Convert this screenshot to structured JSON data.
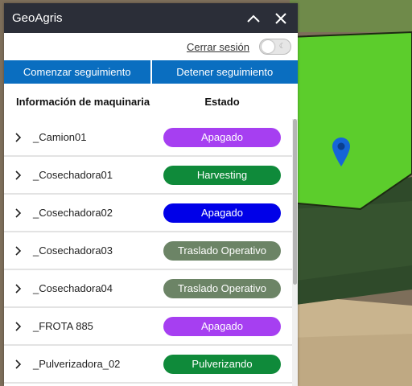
{
  "app": {
    "title": "GeoAgris"
  },
  "titlebar": {
    "collapse_icon": "chevron-up-icon",
    "close_icon": "close-icon"
  },
  "session": {
    "logout_label": "Cerrar sesión",
    "dark_mode_toggle": "off"
  },
  "actions": {
    "start_label": "Comenzar seguimiento",
    "stop_label": "Detener seguimiento",
    "color": "#0a6ec0"
  },
  "table": {
    "headers": {
      "info": "Información de maquinaria",
      "state": "Estado"
    },
    "rows": [
      {
        "name": "_Camion01",
        "status": "Apagado",
        "color": "#a63ff1"
      },
      {
        "name": "_Cosechadora01",
        "status": "Harvesting",
        "color": "#0f8a3a"
      },
      {
        "name": "_Cosechadora02",
        "status": "Apagado",
        "color": "#0000e8"
      },
      {
        "name": "_Cosechadora03",
        "status": "Traslado Operativo",
        "color": "#6c8466"
      },
      {
        "name": "_Cosechadora04",
        "status": "Traslado Operativo",
        "color": "#6c8466"
      },
      {
        "name": "_FROTA 885",
        "status": "Apagado",
        "color": "#a63ff1"
      },
      {
        "name": "_Pulverizadora_02",
        "status": "Pulverizando",
        "color": "#0f8a3a"
      }
    ]
  },
  "map": {
    "marker_icon": "map-pin-icon",
    "marker_color": "#1565d8",
    "field_color": "#5ccd2c"
  }
}
